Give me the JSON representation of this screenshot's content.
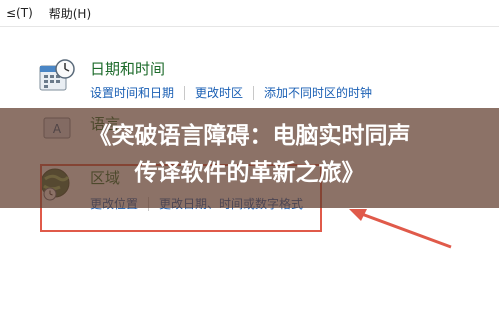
{
  "menu": {
    "items": [
      {
        "label": "≤(T)"
      },
      {
        "label": "帮助(H)"
      }
    ]
  },
  "date_time": {
    "title": "日期和时间",
    "links": [
      "设置时间和日期",
      "更改时区",
      "添加不同时区的时钟"
    ],
    "icon": "calendar-clock-icon"
  },
  "language": {
    "title": "语言",
    "icon": "language-icon"
  },
  "region": {
    "title": "区域",
    "links": [
      "更改位置",
      "更改日期、时间或数字格式"
    ],
    "icon": "globe-clock-icon"
  },
  "banner": {
    "line1": "《突破语言障碍：电脑实时同声",
    "line2": "传译软件的革新之旅》"
  },
  "colors": {
    "title_green": "#1d6b2b",
    "link_blue": "#1a5fb4",
    "annotation_red": "#e05a4a"
  }
}
